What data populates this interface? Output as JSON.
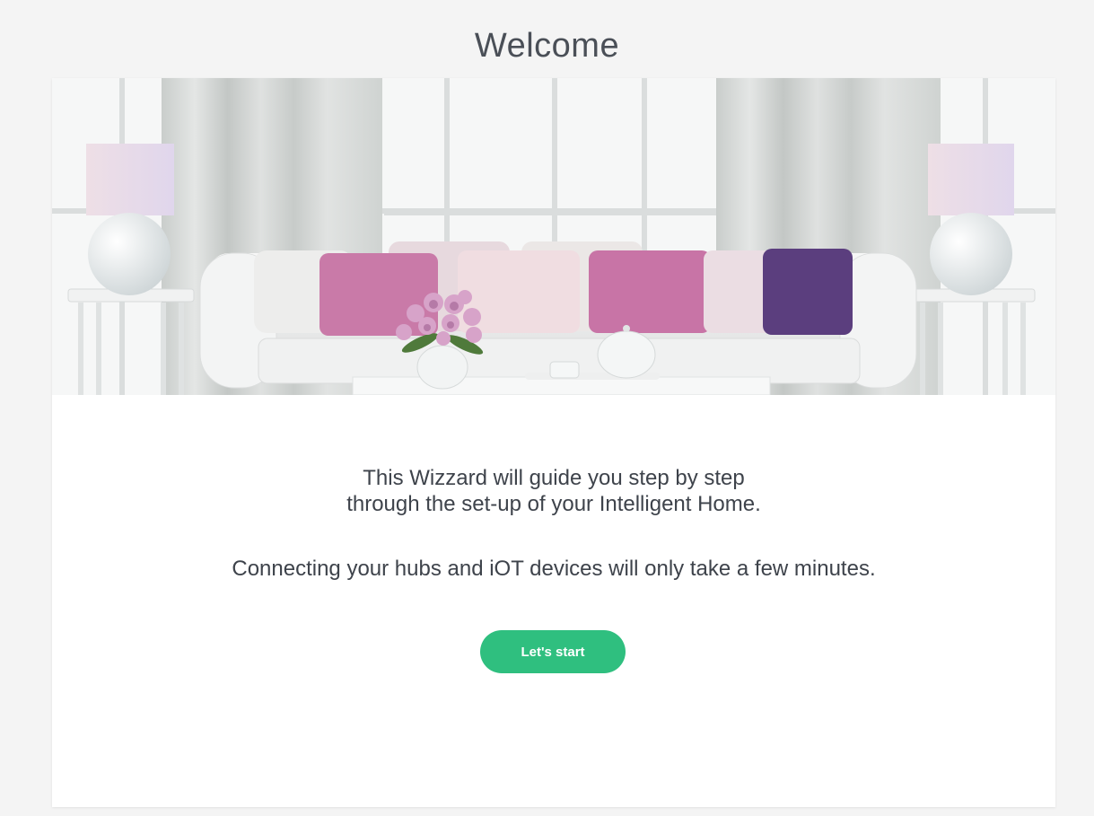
{
  "page": {
    "title": "Welcome"
  },
  "hero": {
    "alt": "Living room with a white sofa, pink and purple cushions, lamps and a vase of tulips"
  },
  "intro": {
    "line1": "This Wizzard will guide you step by step",
    "line2": "through the set-up of your Intelligent Home.",
    "line3": "Connecting your hubs and iOT devices will only take a few minutes."
  },
  "actions": {
    "start_label": "Let's start"
  },
  "colors": {
    "accent": "#2fbf7f",
    "background": "#f4f4f4",
    "card": "#ffffff",
    "text": "#3e434b"
  }
}
